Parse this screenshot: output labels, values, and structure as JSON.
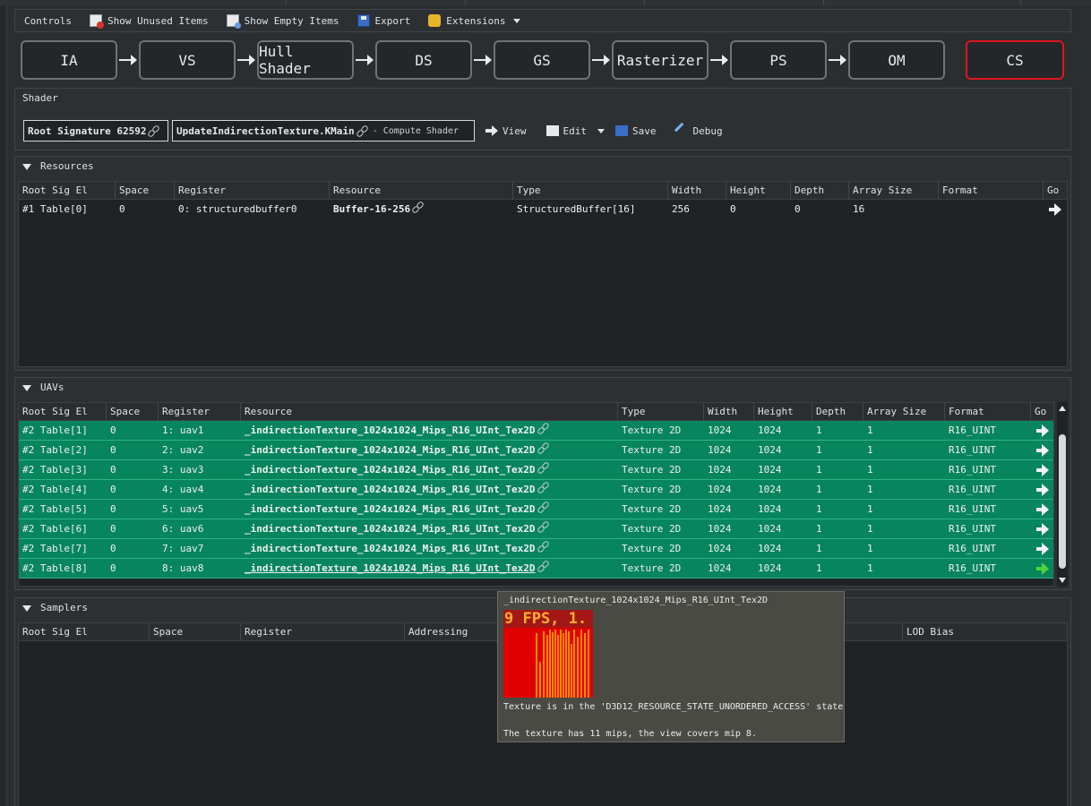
{
  "toolbar": {
    "controls_label": "Controls",
    "show_unused_label": "Show Unused Items",
    "show_empty_label": "Show Empty Items",
    "export_label": "Export",
    "extensions_label": "Extensions"
  },
  "pipeline": {
    "stages": [
      "IA",
      "VS",
      "Hull Shader",
      "DS",
      "GS",
      "Rasterizer",
      "PS",
      "OM",
      "CS"
    ],
    "selected": "CS"
  },
  "shader": {
    "title": "Shader",
    "root_signature": "Root Signature 62592",
    "entry": "UpdateIndirectionTexture.KMain",
    "stage_label": "- Compute Shader",
    "view_label": "View",
    "edit_label": "Edit",
    "save_label": "Save",
    "debug_label": "Debug"
  },
  "resources": {
    "title": "Resources",
    "columns": [
      "Root Sig El",
      "Space",
      "Register",
      "Resource",
      "Type",
      "Width",
      "Height",
      "Depth",
      "Array Size",
      "Format",
      "Go"
    ],
    "rows": [
      {
        "root": "#1 Table[0]",
        "space": "0",
        "register": "0: structuredbuffer0",
        "resource": "Buffer-16-256",
        "type": "StructuredBuffer[16]",
        "width": "256",
        "height": "0",
        "depth": "0",
        "array": "16",
        "format": ""
      }
    ]
  },
  "uavs": {
    "title": "UAVs",
    "columns": [
      "Root Sig El",
      "Space",
      "Register",
      "Resource",
      "Type",
      "Width",
      "Height",
      "Depth",
      "Array Size",
      "Format",
      "Go"
    ],
    "rows": [
      {
        "root": "#2 Table[1]",
        "space": "0",
        "register": "1: uav1",
        "resource": "_indirectionTexture_1024x1024_Mips_R16_UInt_Tex2D",
        "type": "Texture 2D",
        "width": "1024",
        "height": "1024",
        "depth": "1",
        "array": "1",
        "format": "R16_UINT"
      },
      {
        "root": "#2 Table[2]",
        "space": "0",
        "register": "2: uav2",
        "resource": "_indirectionTexture_1024x1024_Mips_R16_UInt_Tex2D",
        "type": "Texture 2D",
        "width": "1024",
        "height": "1024",
        "depth": "1",
        "array": "1",
        "format": "R16_UINT"
      },
      {
        "root": "#2 Table[3]",
        "space": "0",
        "register": "3: uav3",
        "resource": "_indirectionTexture_1024x1024_Mips_R16_UInt_Tex2D",
        "type": "Texture 2D",
        "width": "1024",
        "height": "1024",
        "depth": "1",
        "array": "1",
        "format": "R16_UINT"
      },
      {
        "root": "#2 Table[4]",
        "space": "0",
        "register": "4: uav4",
        "resource": "_indirectionTexture_1024x1024_Mips_R16_UInt_Tex2D",
        "type": "Texture 2D",
        "width": "1024",
        "height": "1024",
        "depth": "1",
        "array": "1",
        "format": "R16_UINT"
      },
      {
        "root": "#2 Table[5]",
        "space": "0",
        "register": "5: uav5",
        "resource": "_indirectionTexture_1024x1024_Mips_R16_UInt_Tex2D",
        "type": "Texture 2D",
        "width": "1024",
        "height": "1024",
        "depth": "1",
        "array": "1",
        "format": "R16_UINT"
      },
      {
        "root": "#2 Table[6]",
        "space": "0",
        "register": "6: uav6",
        "resource": "_indirectionTexture_1024x1024_Mips_R16_UInt_Tex2D",
        "type": "Texture 2D",
        "width": "1024",
        "height": "1024",
        "depth": "1",
        "array": "1",
        "format": "R16_UINT"
      },
      {
        "root": "#2 Table[7]",
        "space": "0",
        "register": "7: uav7",
        "resource": "_indirectionTexture_1024x1024_Mips_R16_UInt_Tex2D",
        "type": "Texture 2D",
        "width": "1024",
        "height": "1024",
        "depth": "1",
        "array": "1",
        "format": "R16_UINT"
      },
      {
        "root": "#2 Table[8]",
        "space": "0",
        "register": "8: uav8",
        "resource": "_indirectionTexture_1024x1024_Mips_R16_UInt_Tex2D",
        "type": "Texture 2D",
        "width": "1024",
        "height": "1024",
        "depth": "1",
        "array": "1",
        "format": "R16_UINT"
      }
    ]
  },
  "samplers": {
    "title": "Samplers",
    "columns": [
      "Root Sig El",
      "Space",
      "Register",
      "Addressing",
      "LOD Bias"
    ]
  },
  "tooltip": {
    "title": "_indirectionTexture_1024x1024_Mips_R16_UInt_Tex2D",
    "thumb_text": "9 FPS, 1.",
    "state_line": "Texture is in the 'D3D12_RESOURCE_STATE_UNORDERED_ACCESS' state",
    "mips_line": "The texture has 11 mips, the view covers mip 8."
  },
  "colors": {
    "selected_stage_border": "#e0141e",
    "uav_row_bg": "#07855d",
    "go_active": "#4cd53a"
  }
}
